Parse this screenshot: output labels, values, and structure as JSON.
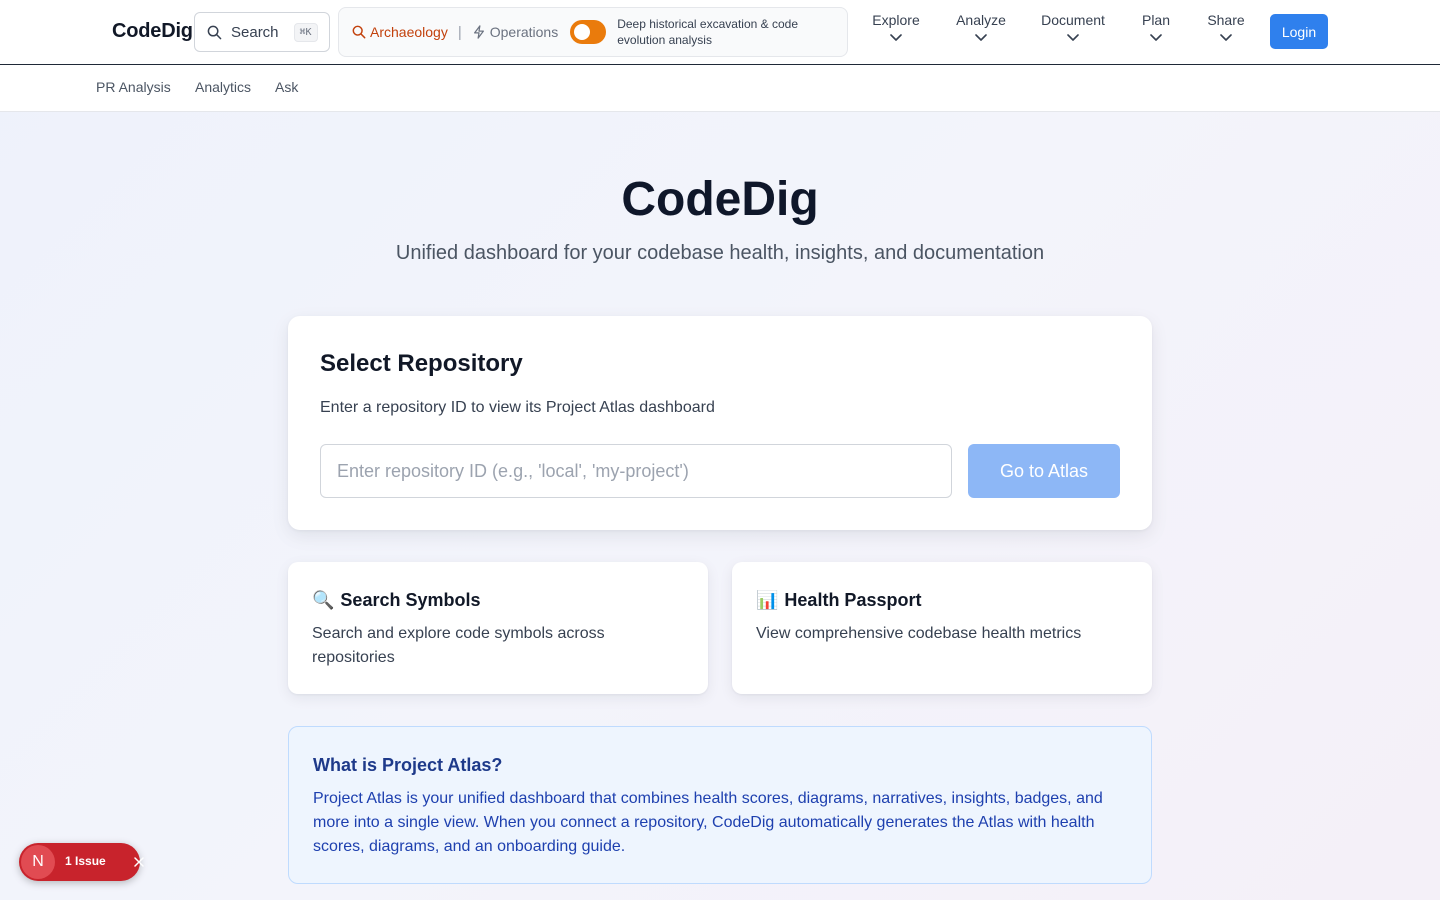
{
  "header": {
    "brand": "CodeDig",
    "search": {
      "label": "Search",
      "shortcut": "⌘K"
    },
    "modes": {
      "archaeology": "Archaeology",
      "operations": "Operations",
      "description": "Deep historical excavation & code evolution analysis"
    },
    "menus": [
      "Explore",
      "Analyze",
      "Document",
      "Plan",
      "Share"
    ],
    "login_label": "Login"
  },
  "subnav": [
    "PR Analysis",
    "Analytics",
    "Ask"
  ],
  "hero": {
    "title": "CodeDig",
    "subtitle": "Unified dashboard for your codebase health, insights, and documentation"
  },
  "repo_card": {
    "title": "Select Repository",
    "description": "Enter a repository ID to view its Project Atlas dashboard",
    "input_placeholder": "Enter repository ID (e.g., 'local', 'my-project')",
    "input_value": "",
    "button_label": "Go to Atlas"
  },
  "features": [
    {
      "emoji": "🔍",
      "title": "Search Symbols",
      "description": "Search and explore code symbols across repositories"
    },
    {
      "emoji": "📊",
      "title": "Health Passport",
      "description": "View comprehensive codebase health metrics"
    }
  ],
  "info": {
    "title": "What is Project Atlas?",
    "body": "Project Atlas is your unified dashboard that combines health scores, diagrams, narratives, insights, badges, and more into a single view. When you connect a repository, CodeDig automatically generates the Atlas with health scores, diagrams, and an onboarding guide."
  },
  "issues": {
    "badge": "N",
    "label": "1 Issue"
  },
  "colors": {
    "primary": "#2f80ed",
    "primary_disabled": "#8db7f6",
    "archaeology": "#c2410c",
    "toggle": "#ea7b0c",
    "issues": "#c8232c",
    "info_text": "#1e40af"
  }
}
